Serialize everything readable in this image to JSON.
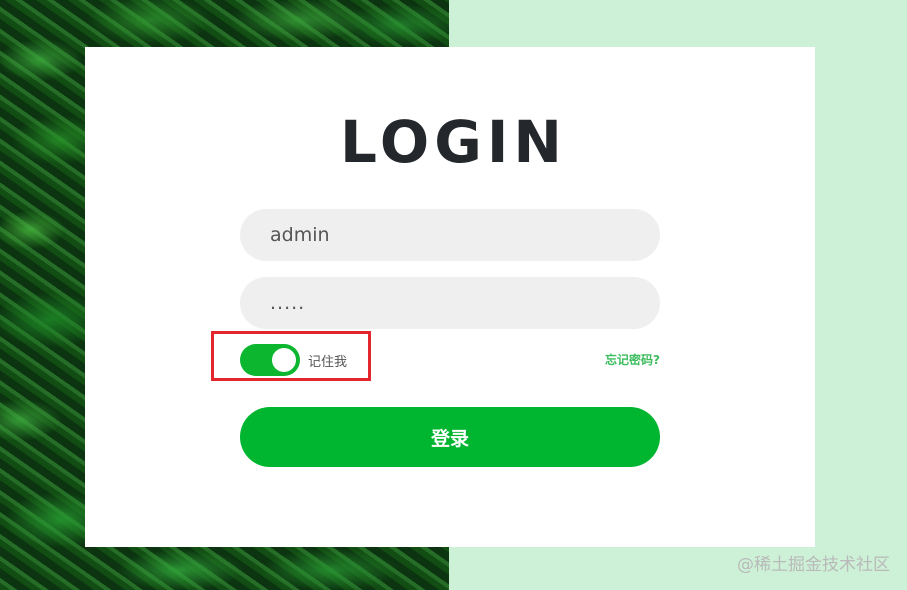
{
  "login": {
    "title": "LOGIN",
    "username_value": "admin",
    "password_value": ".....",
    "remember_label": "记住我",
    "remember_checked": true,
    "forgot_label": "忘记密码?",
    "submit_label": "登录"
  },
  "watermark": {
    "text": "@稀土掘金技术社区"
  },
  "colors": {
    "accent": "#00b530",
    "right_background": "#cdf1d7",
    "highlight": "#e3262e",
    "title": "#24272b"
  }
}
